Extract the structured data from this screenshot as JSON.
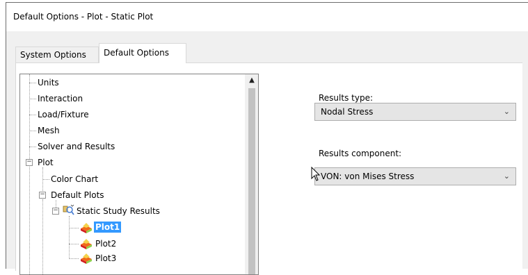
{
  "window": {
    "title": "Default Options - Plot - Static Plot"
  },
  "tabs": [
    {
      "label": "System Options",
      "active": false
    },
    {
      "label": "Default Options",
      "active": true
    }
  ],
  "tree": {
    "items": {
      "units": "Units",
      "interaction": "Interaction",
      "load_fixture": "Load/Fixture",
      "mesh": "Mesh",
      "solver_results": "Solver and Results",
      "plot": "Plot",
      "color_chart": "Color Chart",
      "default_plots": "Default Plots",
      "static_study_results": "Static Study Results",
      "plot1": "Plot1",
      "plot2": "Plot2",
      "plot3": "Plot3"
    },
    "selected": "Plot1"
  },
  "results_type": {
    "label": "Results type:",
    "value": "Nodal Stress"
  },
  "results_component": {
    "label": "Results component:",
    "value": "VON: von Mises Stress"
  },
  "icons": {
    "expand_collapse": "minus-box-icon",
    "scroll_up": "chevron-up-icon",
    "dropdown": "chevron-down-icon",
    "plot": "plot-icon",
    "study": "study-results-icon"
  },
  "colors": {
    "selection": "#3399ff",
    "combo_bg": "#e5e5e5"
  }
}
